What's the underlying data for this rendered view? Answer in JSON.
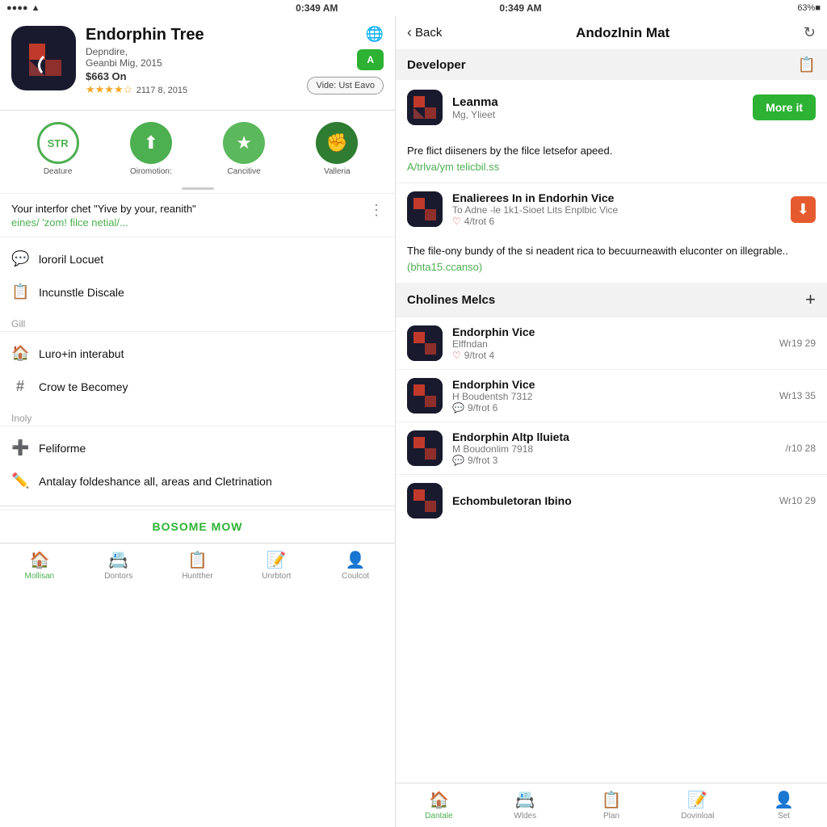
{
  "statusBar": {
    "left": "●●●●●▲",
    "centerLeft": "0:349 AM",
    "rightLeft": "◀ ▶ 63%■",
    "centerRight": "0:349 AM",
    "rightRight": "◀ ▶ 63%■"
  },
  "leftPanel": {
    "appTitle": "Endorphin Tree",
    "appSubtitle": "Depndire,",
    "appDate": "Geanbi Mig, 2015",
    "appPrice": "$663 On",
    "appRating": "★★★★☆",
    "appRatingDate": "2117 8, 2015",
    "videoButton": "Vide: Ust Eavo",
    "features": [
      {
        "label": "STR\nDeature",
        "type": "outline",
        "text": "STR"
      },
      {
        "label": "Oiromotion:",
        "type": "green",
        "text": "⬆"
      },
      {
        "label": "Cancitive",
        "type": "star",
        "text": "★"
      },
      {
        "label": "Valleria",
        "type": "dark",
        "text": "👊"
      }
    ],
    "reviewText": "Your interfor chet \"Yive by your, reanith\"",
    "reviewLink": "eines/ 'zom! filce netial/...",
    "menuSections": [
      {
        "label": "",
        "items": [
          {
            "icon": "💬",
            "text": "lororil Locuet"
          },
          {
            "icon": "📋",
            "text": "Incunstle Discale"
          }
        ]
      },
      {
        "label": "Gill",
        "items": [
          {
            "icon": "🏠",
            "text": "Luro+in interabut"
          },
          {
            "icon": "🔢",
            "text": "Crow te Becomey"
          }
        ]
      },
      {
        "label": "Inoly",
        "items": [
          {
            "icon": "➕",
            "text": "Feliforme"
          },
          {
            "icon": "✏️",
            "text": "Antalay foldeshance all, areas and Cletrination"
          }
        ]
      }
    ],
    "bottomAction": "BOSOME MOW",
    "navItems": [
      {
        "icon": "🏠",
        "label": "Mollisan",
        "active": true
      },
      {
        "icon": "📇",
        "label": "Dontors",
        "active": false
      },
      {
        "icon": "📋",
        "label": "Huntther",
        "active": false
      },
      {
        "icon": "📝",
        "label": "Unrbtort",
        "active": false
      },
      {
        "icon": "👤",
        "label": "Coulcot",
        "active": false
      }
    ]
  },
  "rightPanel": {
    "backLabel": "Back",
    "title": "Andozlnin Mat",
    "developerSection": {
      "sectionTitle": "Developer",
      "devName": "Leanma",
      "devSub": "Mg, Ylieet",
      "moreItLabel": "More it"
    },
    "descText": "Pre flict diiseners by the filce letsefor apeed.",
    "descLink": "A/trlva/ym telicbil.ss",
    "featuredApp": {
      "name": "Enalierees In in Endorhin Vice",
      "sub": "To Adne -le 1k1-Sioet Lits Enplbic Vice",
      "meta": "4/trot 6"
    },
    "longDesc": "The file-ony bundy of the si neadent rica to becuurneawith eluconter on illegrable..",
    "longDescLink": "(bhta15.ccanso)",
    "collectionsTitle": "Cholines Melcs",
    "appList": [
      {
        "name": "Endorphin Vice",
        "sub": "Elffndan",
        "meta": "9/trot 4",
        "date": "Wr19 29",
        "metaIcon": "♡"
      },
      {
        "name": "Endorphin Vice",
        "sub": "H Boudentsh 7312",
        "meta": "9/frot 6",
        "date": "Wr13 35",
        "metaIcon": "💬"
      },
      {
        "name": "Endorphin Altp lluieta",
        "sub": "M Boudonlim 7918",
        "meta": "9/frot 3",
        "date": "/r10 28",
        "metaIcon": "💬"
      },
      {
        "name": "Echombuletoran Ibino",
        "sub": "",
        "meta": "",
        "date": "Wr10 29",
        "metaIcon": ""
      }
    ],
    "navItems": [
      {
        "icon": "🏠",
        "label": "Dantale",
        "active": true
      },
      {
        "icon": "📇",
        "label": "Wldes",
        "active": false
      },
      {
        "icon": "📋",
        "label": "Plan",
        "active": false
      },
      {
        "icon": "📝",
        "label": "Dovinloal",
        "active": false
      },
      {
        "icon": "👤",
        "label": "Set",
        "active": false
      }
    ]
  }
}
